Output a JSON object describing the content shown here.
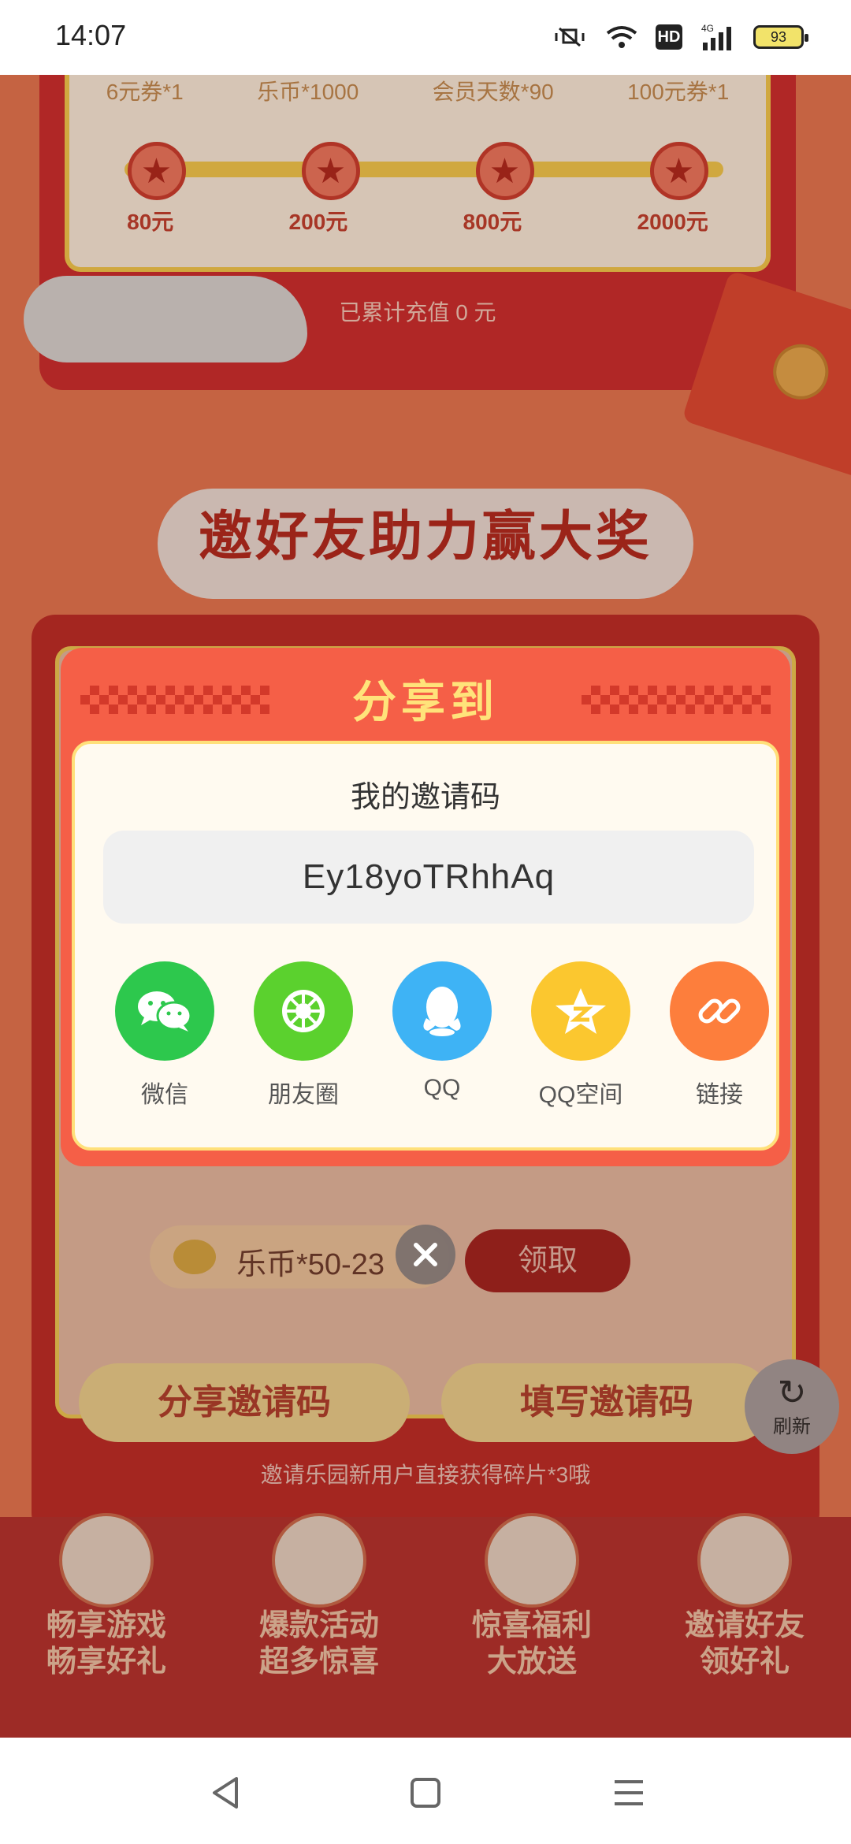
{
  "status_bar": {
    "time": "14:07",
    "network": "4G",
    "hd_label": "HD",
    "battery": "93"
  },
  "background": {
    "rewards": [
      "6元券*1",
      "乐币*1000",
      "会员天数*90",
      "100元券*1"
    ],
    "milestones": [
      "80元",
      "200元",
      "800元",
      "2000元"
    ],
    "accumulated_text": "已累计充值 0 元",
    "banner_title": "邀好友助力赢大奖",
    "coin_text": "乐币*50-23",
    "claim_label": "领取",
    "share_code_button": "分享邀请码",
    "fill_code_button": "填写邀请码",
    "refresh_label": "刷新",
    "invite_note": "邀请乐园新用户直接获得碎片*3哦",
    "features": [
      {
        "line1": "畅享游戏",
        "line2": "畅享好礼"
      },
      {
        "line1": "爆款活动",
        "line2": "超多惊喜"
      },
      {
        "line1": "惊喜福利",
        "line2": "大放送"
      },
      {
        "line1": "邀请好友",
        "line2": "领好礼"
      }
    ]
  },
  "dialog": {
    "title": "分享到",
    "code_label": "我的邀请码",
    "invite_code": "Ey18yoTRhhAq",
    "share_targets": [
      {
        "label": "微信",
        "icon": "wechat-icon",
        "color": "#2dc84d"
      },
      {
        "label": "朋友圈",
        "icon": "moments-icon",
        "color": "#5bd12e"
      },
      {
        "label": "QQ",
        "icon": "qq-icon",
        "color": "#3eb3f5"
      },
      {
        "label": "QQ空间",
        "icon": "qzone-icon",
        "color": "#fbc72f"
      },
      {
        "label": "链接",
        "icon": "link-icon",
        "color": "#fd7e3c"
      }
    ]
  },
  "colors": {
    "dialog_red": "#f55f47",
    "title_yellow": "#ffe37a"
  }
}
